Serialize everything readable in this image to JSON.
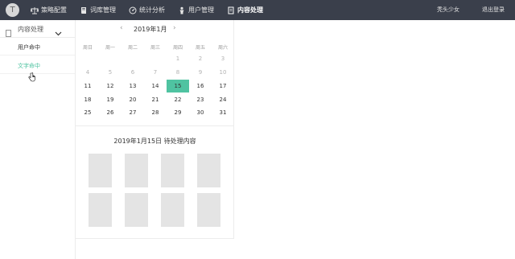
{
  "header": {
    "logo_glyph": "T",
    "nav": [
      {
        "label": "策略配置",
        "icon": "scale-icon"
      },
      {
        "label": "词库管理",
        "icon": "book-icon"
      },
      {
        "label": "统计分析",
        "icon": "gauge-icon"
      },
      {
        "label": "用户管理",
        "icon": "person-icon"
      },
      {
        "label": "内容处理",
        "icon": "document-icon",
        "active": true
      }
    ],
    "user_name": "秃头少女",
    "logout_label": "退出登录"
  },
  "sidebar": {
    "section_label": "内容处理",
    "items": [
      {
        "label": "用户命中",
        "active": false
      },
      {
        "label": "文字命中",
        "active": true
      }
    ]
  },
  "calendar": {
    "prev_glyph": "‹",
    "next_glyph": "›",
    "month_label": "2019年1月",
    "weekdays": [
      "周日",
      "周一",
      "周二",
      "周三",
      "周四",
      "周五",
      "周六"
    ],
    "weeks": [
      [
        "",
        "",
        "",
        "",
        "1",
        "2",
        "3"
      ],
      [
        "4",
        "5",
        "6",
        "7",
        "8",
        "9",
        "10"
      ],
      [
        "11",
        "12",
        "13",
        "14",
        "15",
        "16",
        "17"
      ],
      [
        "18",
        "19",
        "20",
        "21",
        "22",
        "23",
        "24"
      ],
      [
        "25",
        "26",
        "27",
        "28",
        "29",
        "30",
        "31"
      ]
    ],
    "dimmed_days": [
      "1",
      "2",
      "3",
      "4",
      "5",
      "6",
      "7",
      "8",
      "9",
      "10"
    ],
    "selected_day": "15",
    "accent_color": "#4fc3a1"
  },
  "pending": {
    "title": "2019年1月15日 待处理内容",
    "placeholder_count": 8
  },
  "colors": {
    "topbar": "#3a3f4b",
    "accent": "#4fc3a1",
    "placeholder": "#e4e4e4"
  }
}
